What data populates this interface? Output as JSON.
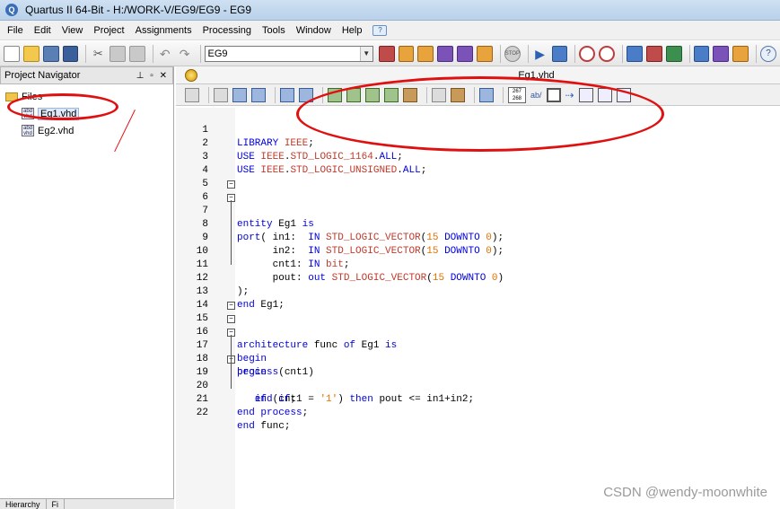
{
  "window": {
    "title": "Quartus II 64-Bit - H:/WORK-V/EG9/EG9 - EG9"
  },
  "menu": [
    "File",
    "Edit",
    "View",
    "Project",
    "Assignments",
    "Processing",
    "Tools",
    "Window",
    "Help"
  ],
  "toolbar": {
    "project_combo": "EG9",
    "stop_label": "STOP"
  },
  "navigator": {
    "title": "Project Navigator",
    "folder_label": "Files",
    "files": [
      "Eg1.vhd",
      "Eg2.vhd"
    ],
    "tabs": [
      "Hierarchy",
      "Fi"
    ]
  },
  "editor": {
    "filename": "Eg1.vhd",
    "toolbar": {
      "line_count_label": "267 268",
      "ab_label": "ab/"
    },
    "lines": [
      "1",
      "2",
      "3",
      "4",
      "5",
      "6",
      "7",
      "8",
      "9",
      "10",
      "11",
      "12",
      "13",
      "14",
      "15",
      "16",
      "17",
      "18",
      "19",
      "20",
      "21",
      "22"
    ]
  },
  "watermark": "CSDN @wendy-moonwhite",
  "colors": {
    "keyword": "#0000dd",
    "type": "#c0392b",
    "number": "#e07000",
    "annotation": "#e01010"
  }
}
